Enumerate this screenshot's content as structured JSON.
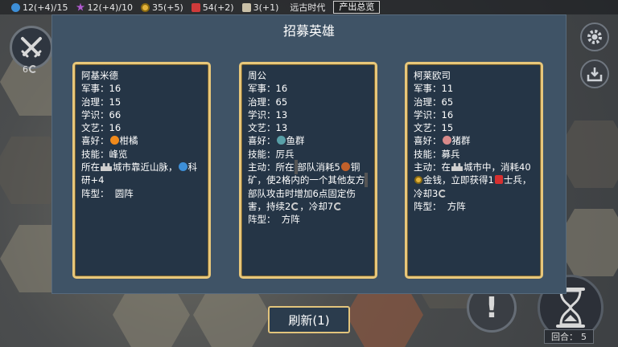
{
  "resources": {
    "science": "12(+4)/15",
    "culture": "12(+4)/10",
    "gold": "35(+5)",
    "food": "54(+2)",
    "population": "3(+1)",
    "era": "远古时代",
    "overview_label": "产出总览"
  },
  "battle": {
    "count": "6"
  },
  "modal": {
    "title": "招募英雄",
    "refresh_label": "刷新(1)"
  },
  "heroes": [
    {
      "name": "阿基米德",
      "military": "军事：16",
      "governance": "治理：15",
      "knowledge": "学识：66",
      "arts": "文艺：16",
      "hobby_prefix": "喜好：",
      "hobby": "柑橘",
      "skill": "技能：峰览",
      "detail_a": "所在",
      "detail_b": "城市靠近山脉，",
      "detail_c": "科研+4",
      "formation": "阵型：  圆阵"
    },
    {
      "name": "周公",
      "military": "军事：16",
      "governance": "治理：65",
      "knowledge": "学识：13",
      "arts": "文艺：13",
      "hobby_prefix": "喜好：",
      "hobby": "鱼群",
      "skill": "技能：厉兵",
      "detail_a": "主动：所在",
      "detail_b": "部队消耗5",
      "detail_c": "铜矿，使2格内的一个其他友方",
      "detail_d": "部队攻击时增加6点固定伤害，持续2",
      "detail_e": "，冷却7",
      "formation": "阵型：  方阵"
    },
    {
      "name": "柯莱欧司",
      "military": "军事：11",
      "governance": "治理：65",
      "knowledge": "学识：16",
      "arts": "文艺：15",
      "hobby_prefix": "喜好：",
      "hobby": "猪群",
      "skill": "技能：募兵",
      "detail_a": "主动：在",
      "detail_b": "城市中，消耗40",
      "detail_c": "金钱，立即获得1",
      "detail_d": "士兵，冷却3",
      "formation": "阵型：  方阵"
    }
  ],
  "round": {
    "label": "回合：",
    "value": "5"
  }
}
